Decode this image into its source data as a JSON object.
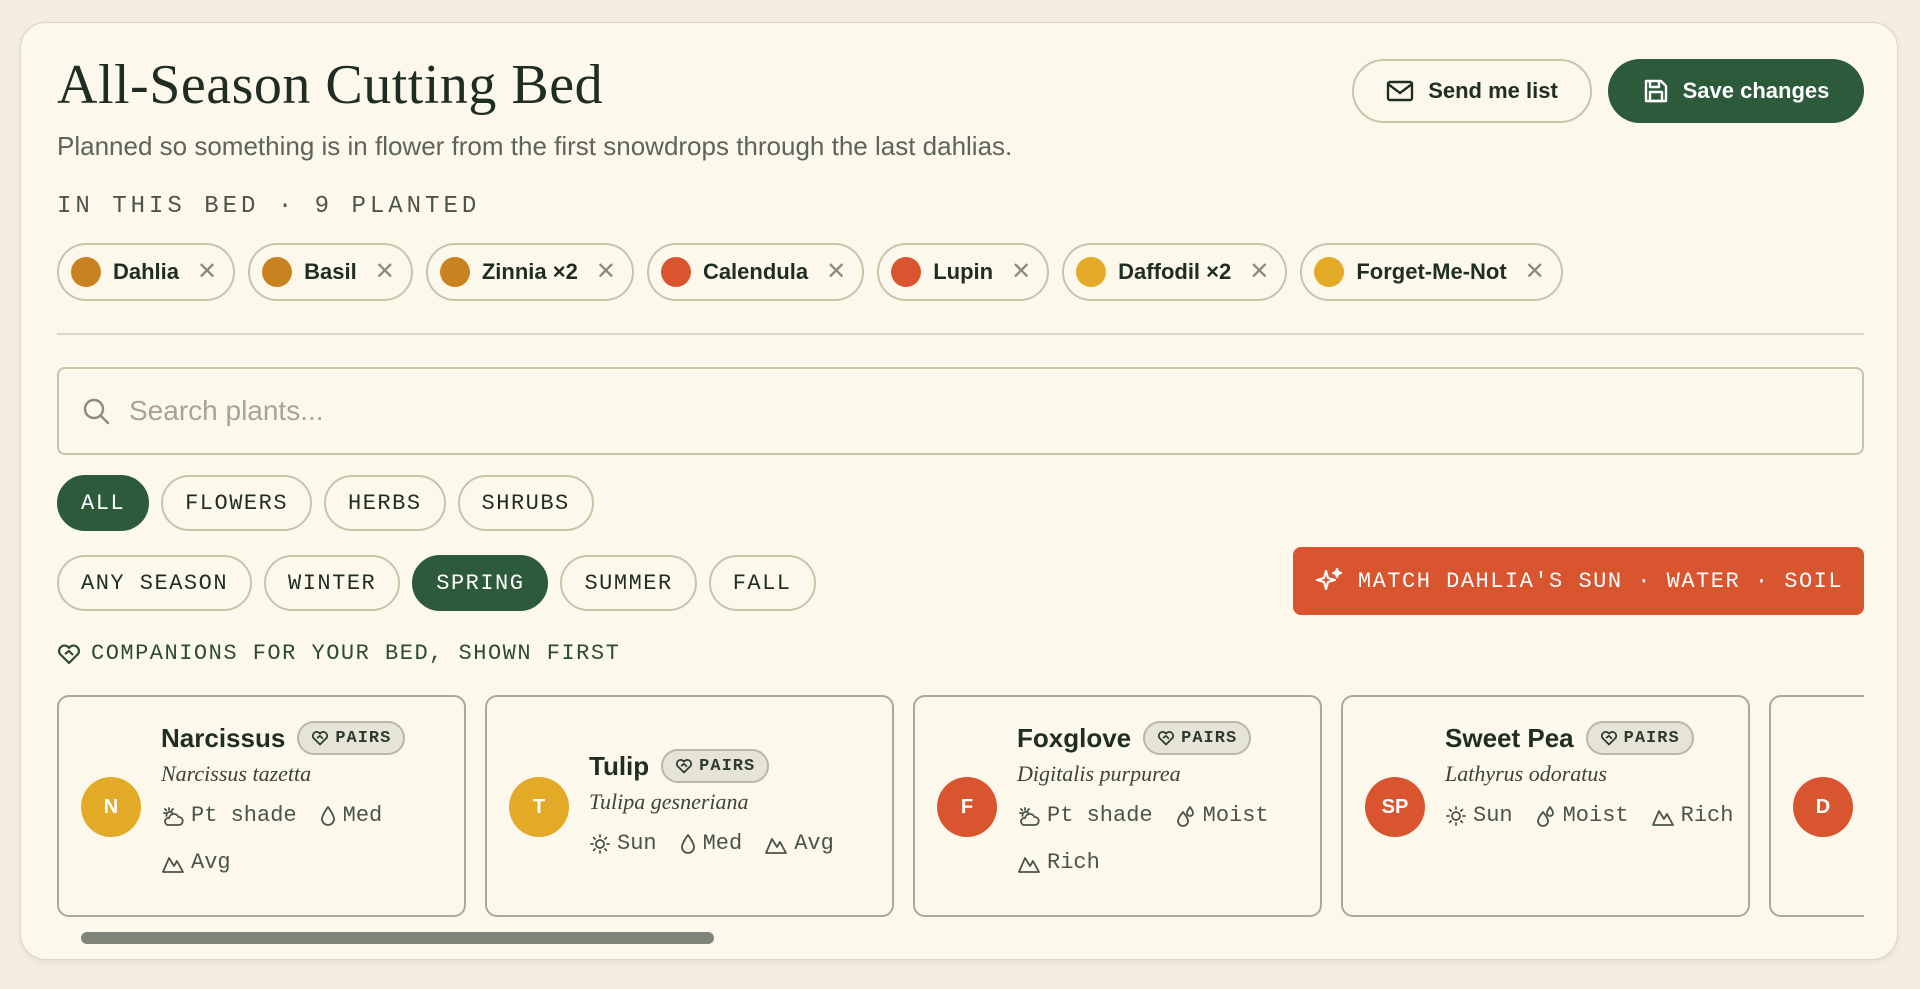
{
  "header": {
    "title": "All-Season Cutting Bed",
    "subtitle": "Planned so something is in flower from the first snowdrops through the last dahlias.",
    "send_label": "Send me list",
    "save_label": "Save changes"
  },
  "bed": {
    "label": "IN THIS BED · 9 PLANTED",
    "chips": [
      {
        "label": "Dahlia",
        "color": "#c98220"
      },
      {
        "label": "Basil",
        "color": "#c98220"
      },
      {
        "label": "Zinnia ×2",
        "color": "#c98220"
      },
      {
        "label": "Calendula",
        "color": "#d95530"
      },
      {
        "label": "Lupin",
        "color": "#d95530"
      },
      {
        "label": "Daffodil ×2",
        "color": "#e2aa26"
      },
      {
        "label": "Forget-Me-Not",
        "color": "#e2aa26"
      }
    ]
  },
  "search": {
    "placeholder": "Search plants..."
  },
  "type_filters": [
    {
      "label": "ALL",
      "active": true
    },
    {
      "label": "FLOWERS",
      "active": false
    },
    {
      "label": "HERBS",
      "active": false
    },
    {
      "label": "SHRUBS",
      "active": false
    }
  ],
  "season_filters": [
    {
      "label": "ANY SEASON",
      "active": false
    },
    {
      "label": "WINTER",
      "active": false
    },
    {
      "label": "SPRING",
      "active": true
    },
    {
      "label": "SUMMER",
      "active": false
    },
    {
      "label": "FALL",
      "active": false
    }
  ],
  "match_button": {
    "label": "MATCH DAHLIA'S SUN · WATER · SOIL",
    "icon": "sparkle-icon"
  },
  "companions": {
    "label": "COMPANIONS FOR YOUR BED, SHOWN FIRST",
    "pairs_label": "PAIRS",
    "cards": [
      {
        "initials": "N",
        "name": "Narcissus",
        "latin": "Narcissus tazetta",
        "color": "#e2aa26",
        "sun": "Pt shade",
        "sun_icon": "partial-shade-icon",
        "water": "Med",
        "water_icon": "drop-icon",
        "soil": "Avg"
      },
      {
        "initials": "T",
        "name": "Tulip",
        "latin": "Tulipa gesneriana",
        "color": "#e2aa26",
        "sun": "Sun",
        "sun_icon": "sun-icon",
        "water": "Med",
        "water_icon": "drop-icon",
        "soil": "Avg"
      },
      {
        "initials": "F",
        "name": "Foxglove",
        "latin": "Digitalis purpurea",
        "color": "#d95530",
        "sun": "Pt shade",
        "sun_icon": "partial-shade-icon",
        "water": "Moist",
        "water_icon": "drops-icon",
        "soil": "Rich"
      },
      {
        "initials": "SP",
        "name": "Sweet Pea",
        "latin": "Lathyrus odoratus",
        "color": "#d95530",
        "sun": "Sun",
        "sun_icon": "sun-icon",
        "water": "Moist",
        "water_icon": "drops-icon",
        "soil": "Rich"
      },
      {
        "initials": "D",
        "color": "#d95530"
      }
    ]
  }
}
